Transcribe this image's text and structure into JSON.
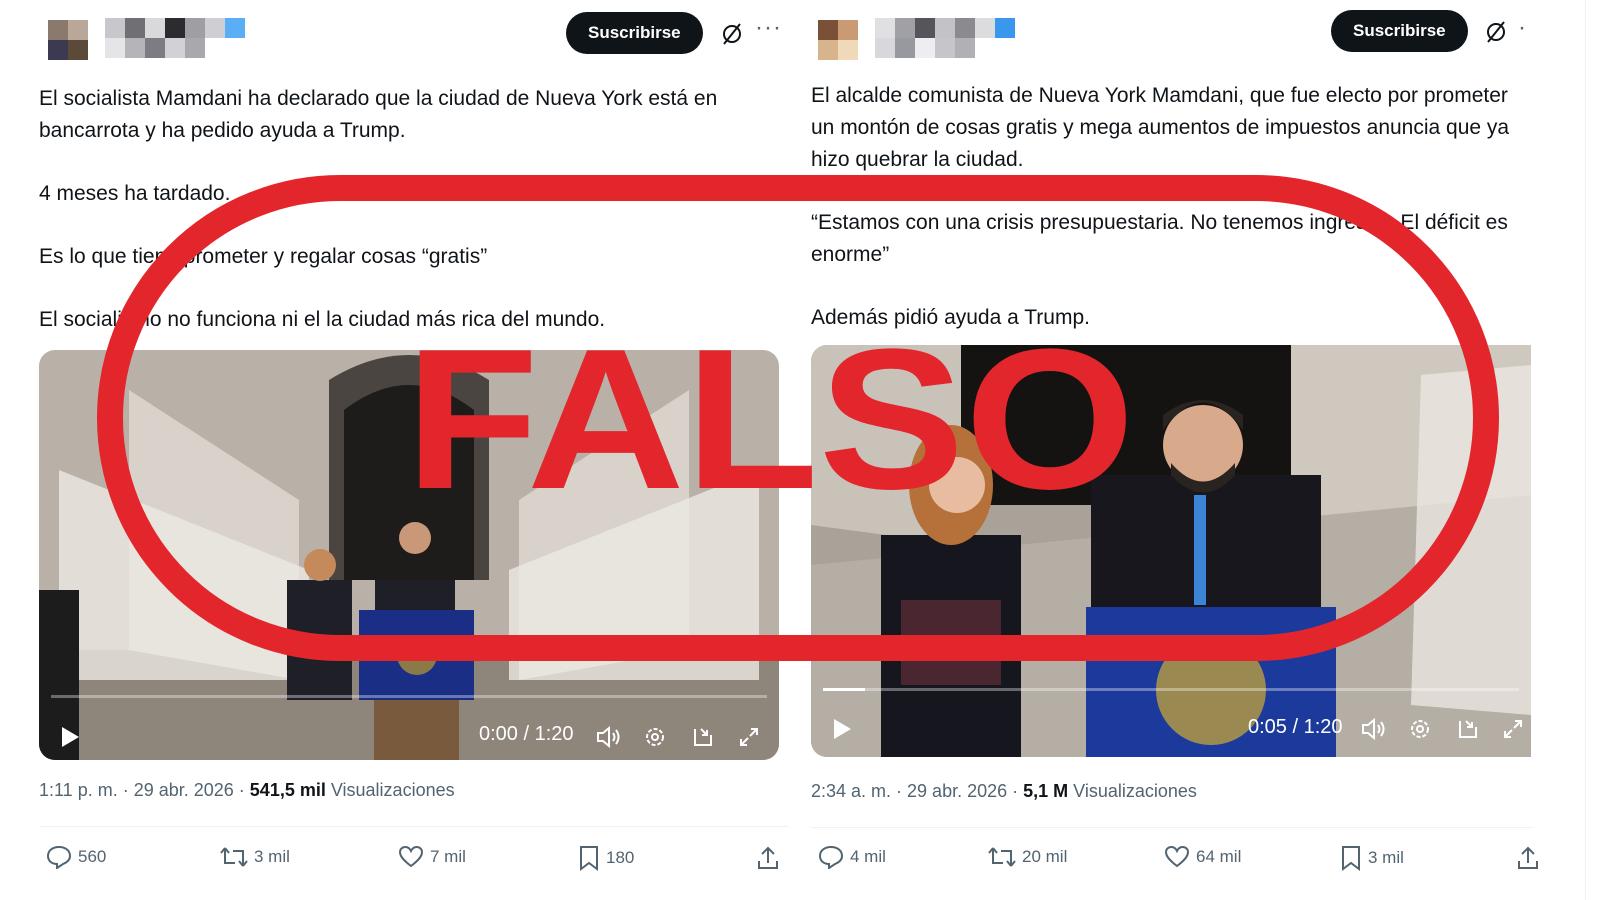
{
  "tweets": [
    {
      "subscribe_label": "Suscribirse",
      "more_label": "···",
      "paragraphs": [
        "El socialista Mamdani ha declarado que la ciudad de Nueva York está en bancarrota y ha pedido ayuda a Trump.",
        "4 meses ha tardado.",
        "Es lo que tiene prometer y regalar cosas “gratis”",
        "El socialismo no funciona ni el la ciudad más rica del mundo."
      ],
      "video": {
        "time": "0:00 / 1:20",
        "progress": 0.0
      },
      "meta": {
        "time": "1:11 p. m. · 29 abr. 2026 · ",
        "views_count": "541,5 mil",
        "views_label": " Visualizaciones"
      },
      "actions": {
        "replies": "560",
        "reposts": "3 mil",
        "likes": "7 mil",
        "bookmarks": "180"
      }
    },
    {
      "subscribe_label": "Suscribirse",
      "more_label": "·",
      "paragraphs": [
        "El alcalde comunista de Nueva York Mamdani, que fue electo por prometer un montón de cosas gratis y mega aumentos de impuestos anuncia que ya hizo quebrar la ciudad.",
        "“Estamos con una crisis presupuestaria. No tenemos ingresos. El déficit es enorme”",
        "Además pidió ayuda a Trump."
      ],
      "video": {
        "time": "0:05 / 1:20",
        "progress": 0.06
      },
      "meta": {
        "time": "2:34 a. m. · 29 abr. 2026 · ",
        "views_count": "5,1 M",
        "views_label": " Visualizaciones"
      },
      "actions": {
        "replies": "4 mil",
        "reposts": "20 mil",
        "likes": "64 mil",
        "bookmarks": "3 mil"
      }
    }
  ],
  "stamp": {
    "label": "FALSO",
    "color": "#e3262b"
  },
  "colors": {
    "accent_dark": "#0f1419",
    "muted": "#536471"
  }
}
